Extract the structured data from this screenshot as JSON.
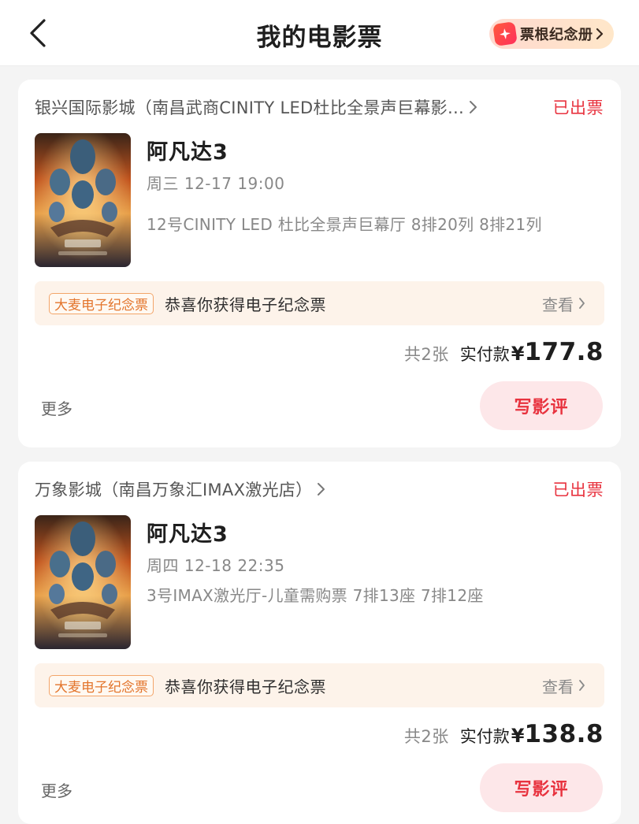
{
  "header": {
    "title": "我的电影票",
    "back_icon": "chevron-left-icon",
    "stub_album_label": "票根纪念册",
    "stub_icon": "sparkle-ticket-icon"
  },
  "colors": {
    "accent_red": "#e8333f",
    "souvenir_bg": "#fdf3ea",
    "souvenir_tag": "#e3752c",
    "review_btn_bg": "#fde7e9"
  },
  "orders": [
    {
      "cinema": "银兴国际影城（南昌武商CINITY LED杜比全景声巨幕影…",
      "status": "已出票",
      "movie": "阿凡达3",
      "showtime": "周三 12-17 19:00",
      "seats": "12号CINITY LED 杜比全景声巨幕厅 8排20列 8排21列",
      "souvenir_tag": "大麦电子纪念票",
      "souvenir_text": "恭喜你获得电子纪念票",
      "souvenir_view": "查看",
      "count": "共2张",
      "paid_label": "实付款",
      "currency": "¥",
      "amount": "177.8",
      "more": "更多",
      "review": "写影评"
    },
    {
      "cinema": "万象影城（南昌万象汇IMAX激光店）",
      "status": "已出票",
      "movie": "阿凡达3",
      "showtime": "周四 12-18 22:35",
      "seats": "3号IMAX激光厅-儿童需购票 7排13座 7排12座",
      "souvenir_tag": "大麦电子纪念票",
      "souvenir_text": "恭喜你获得电子纪念票",
      "souvenir_view": "查看",
      "count": "共2张",
      "paid_label": "实付款",
      "currency": "¥",
      "amount": "138.8",
      "more": "更多",
      "review": "写影评"
    }
  ]
}
